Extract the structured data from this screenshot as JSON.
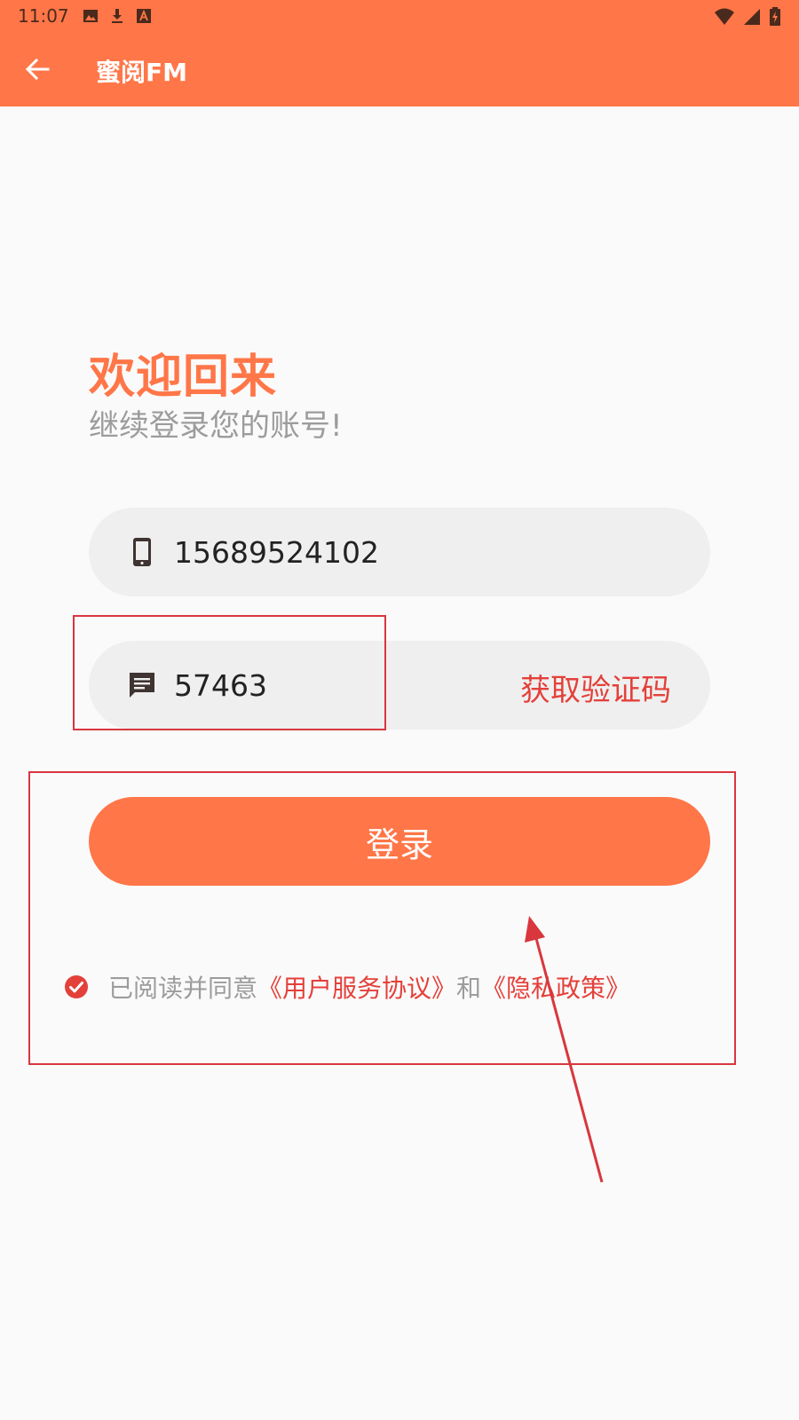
{
  "status_bar": {
    "time": "11:07",
    "left_icons": [
      "image-icon",
      "download-icon",
      "text-a-icon"
    ],
    "right_icons": [
      "wifi-icon",
      "signal-icon",
      "battery-icon"
    ]
  },
  "appbar": {
    "title": "蜜阅FM",
    "back_icon": "back-arrow-icon",
    "background_color": "#ff7648"
  },
  "welcome": {
    "title": "欢迎回来",
    "subtitle": "继续登录您的账号!"
  },
  "phone_field": {
    "icon": "phone-icon",
    "value": "15689524102"
  },
  "code_field": {
    "icon": "message-icon",
    "value": "57463",
    "get_code_label": "获取验证码"
  },
  "login_button": {
    "label": "登录"
  },
  "agreement": {
    "checked": true,
    "prefix": "已阅读并同意",
    "user_agreement": "《用户服务协议》",
    "and": "和",
    "privacy_policy": "《隐私政策》"
  },
  "colors": {
    "accent": "#ff7648",
    "link": "#e4403a",
    "annotation": "#d9363e",
    "field_bg": "#efefef",
    "background": "#fafafa"
  }
}
